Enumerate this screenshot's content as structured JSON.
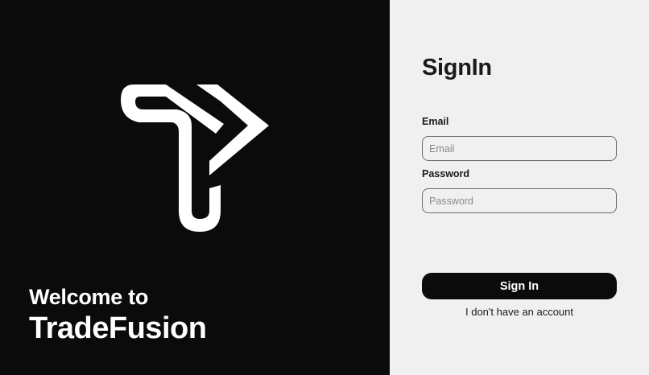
{
  "brand": {
    "welcome": "Welcome to",
    "name": "TradeFusion",
    "logo_icon": "tradefusion-logo-icon"
  },
  "form": {
    "title": "SignIn",
    "email": {
      "label": "Email",
      "placeholder": "Email",
      "value": ""
    },
    "password": {
      "label": "Password",
      "placeholder": "Password",
      "value": ""
    },
    "submit_label": "Sign In",
    "no_account_link": "I don't have an account"
  },
  "colors": {
    "left_bg": "#0b0b0b",
    "right_bg": "#f0f0f0",
    "button_bg": "#0b0b0b",
    "button_text": "#ffffff"
  }
}
